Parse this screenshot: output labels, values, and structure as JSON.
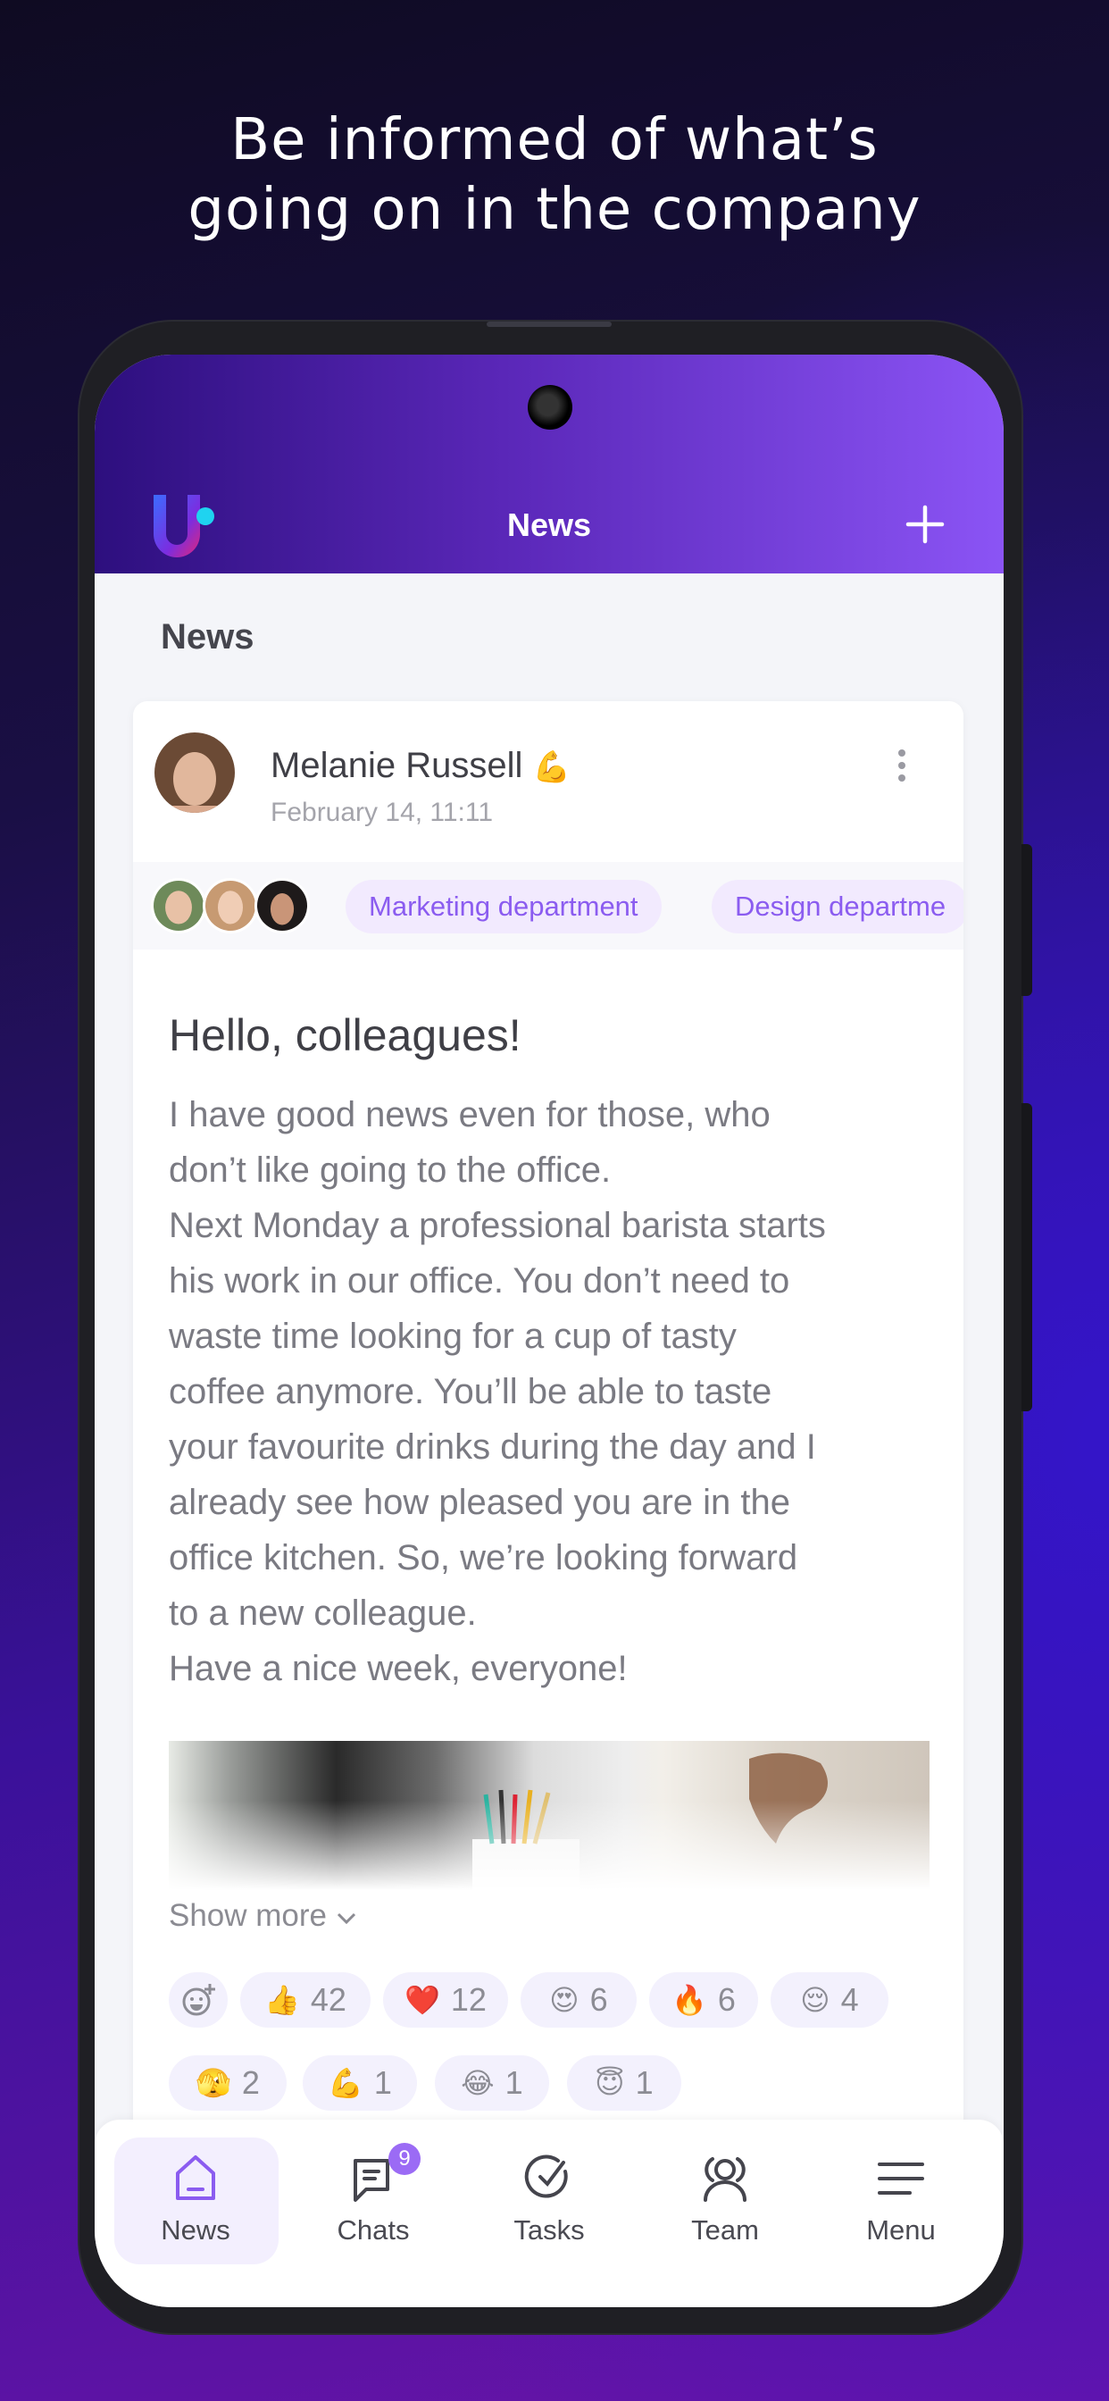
{
  "headline": {
    "lines": [
      "Be informed of what’s",
      "going on in the company"
    ]
  },
  "app_bar": {
    "title": "News",
    "add_icon": "plus-icon",
    "logo": "U"
  },
  "section_title": "News",
  "post": {
    "author": "Melanie Russell",
    "author_emoji": "💪",
    "date": "February 14, 11:11",
    "audience": [
      "Marketing department",
      "Design departme"
    ],
    "title": "Hello, colleagues!",
    "body_lines": [
      "I have good news even for those, who",
      "don’t like going to the office.",
      "Next Monday a professional barista starts",
      "his work in our office. You don’t need to",
      "waste time looking for a cup of tasty",
      "coffee anymore. You’ll be able to taste",
      "your favourite drinks during the day and I",
      "already see how pleased you are in the",
      "office kitchen. So, we’re looking forward",
      "to a new colleague.",
      "Have a nice week, everyone!"
    ],
    "show_more": "Show more",
    "reactions": [
      {
        "emoji": "👍",
        "count": "42"
      },
      {
        "emoji": "❤️",
        "count": "12"
      },
      {
        "emoji": "😍",
        "count": "6"
      },
      {
        "emoji": "🔥",
        "count": "6"
      },
      {
        "emoji": "😌",
        "count": "4"
      },
      {
        "emoji": "🫣",
        "count": "2"
      },
      {
        "emoji": "💪",
        "count": "1"
      },
      {
        "emoji": "😂",
        "count": "1"
      },
      {
        "emoji": "😇",
        "count": "1"
      }
    ]
  },
  "nav": {
    "items": [
      {
        "label": "News",
        "active": true
      },
      {
        "label": "Chats",
        "badge": "9"
      },
      {
        "label": "Tasks"
      },
      {
        "label": "Team"
      },
      {
        "label": "Menu"
      }
    ]
  },
  "colors": {
    "accent": "#8b5cf0",
    "chip_bg": "#f2eafe",
    "badge": "#9b6bf5"
  }
}
